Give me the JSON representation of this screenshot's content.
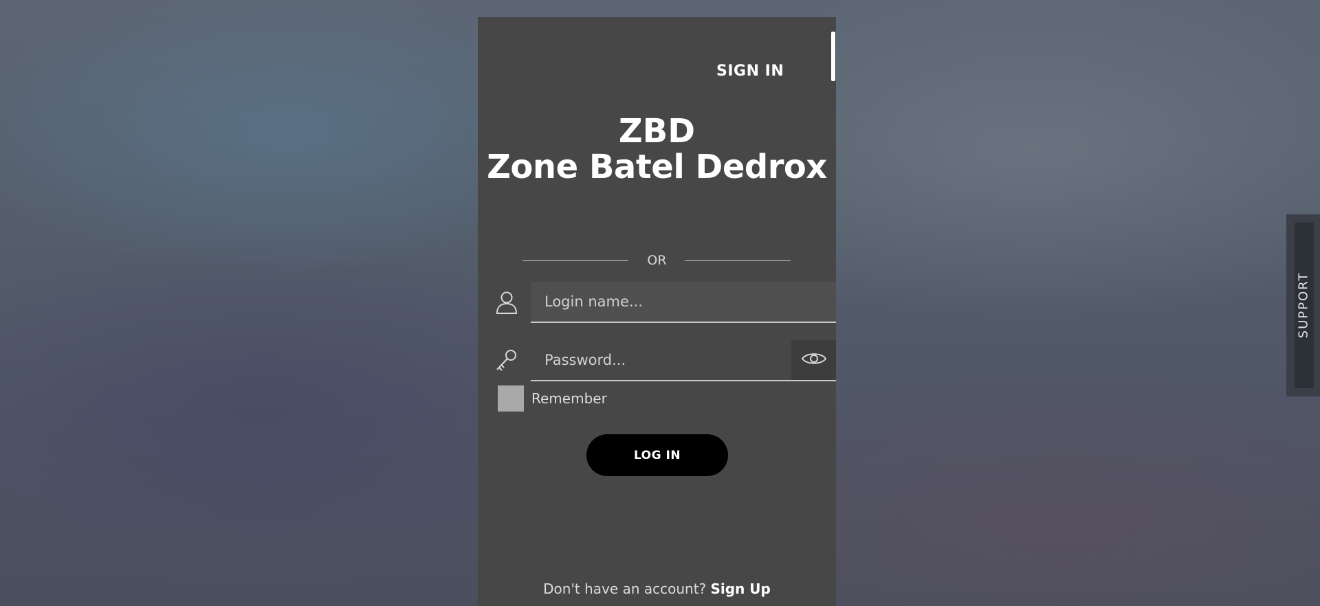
{
  "panel": {
    "tab_signin": "SIGN IN",
    "brand_short": "ZBD",
    "brand_long": "Zone Batel Dedrox",
    "divider_text": "OR",
    "login_field": {
      "placeholder": "Login name..."
    },
    "password_field": {
      "placeholder": "Password..."
    },
    "remember_label": "Remember",
    "login_button": "LOG IN",
    "signup_prompt": "Don't have an account?",
    "signup_link": "Sign Up"
  },
  "support_tab": {
    "label": "SUPPORT"
  },
  "icons": {
    "user": "user-icon",
    "key": "key-icon",
    "eye": "eye-icon"
  },
  "colors": {
    "panel_bg": "#474747",
    "button_bg": "#000000",
    "text": "#ffffff"
  }
}
